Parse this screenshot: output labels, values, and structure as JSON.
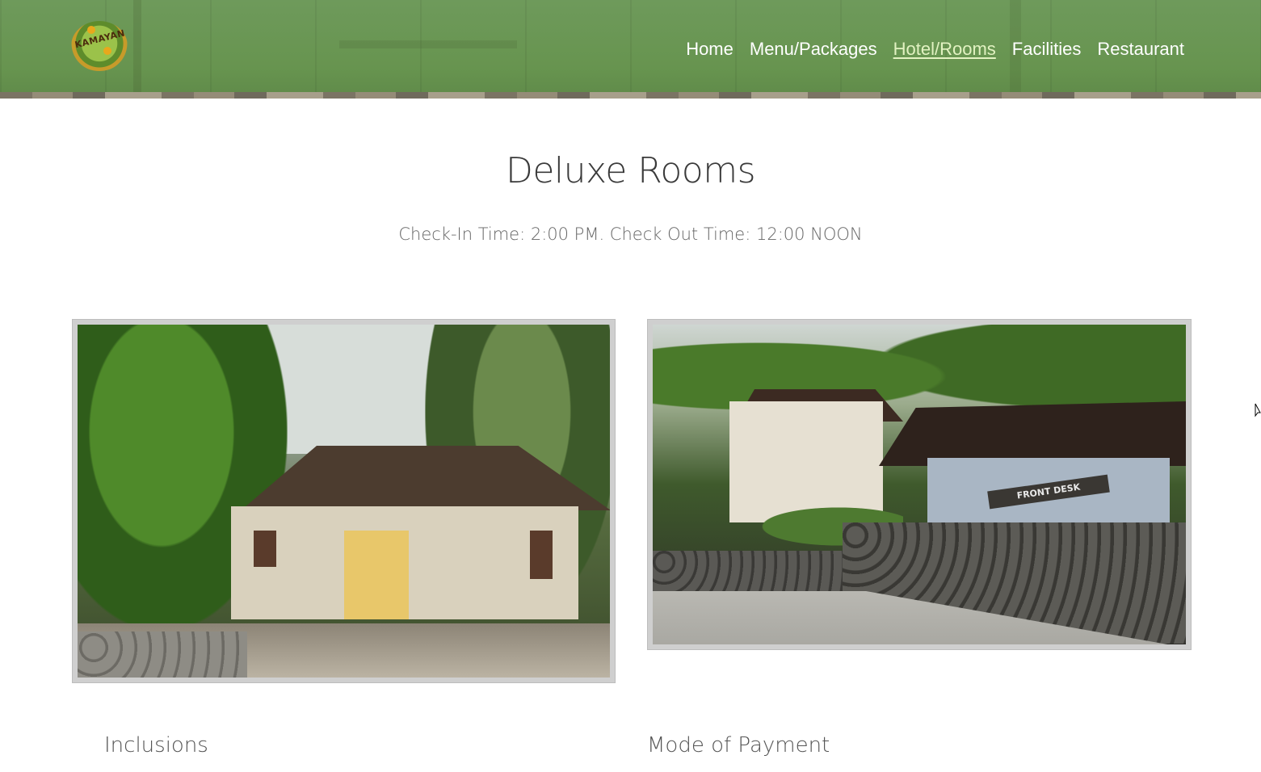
{
  "header": {
    "logo_text": "KAMAYAN",
    "nav": [
      {
        "label": "Home",
        "active": false
      },
      {
        "label": "Menu/Packages",
        "active": false
      },
      {
        "label": "Hotel/Rooms",
        "active": true
      },
      {
        "label": "Facilities",
        "active": false
      },
      {
        "label": "Restaurant",
        "active": false
      }
    ]
  },
  "main": {
    "title": "Deluxe Rooms",
    "subtitle": "Check-In Time: 2:00 PM. Check Out Time: 12:00 NOON",
    "photos": [
      {
        "name": "deluxe-room-house-photo"
      },
      {
        "name": "front-desk-photo",
        "sign_text": "FRONT DESK"
      }
    ],
    "sections": {
      "inclusions": "Inclusions",
      "payment": "Mode of Payment"
    }
  },
  "colors": {
    "header_green": "#67944f",
    "nav_active": "#e2f2c2"
  }
}
